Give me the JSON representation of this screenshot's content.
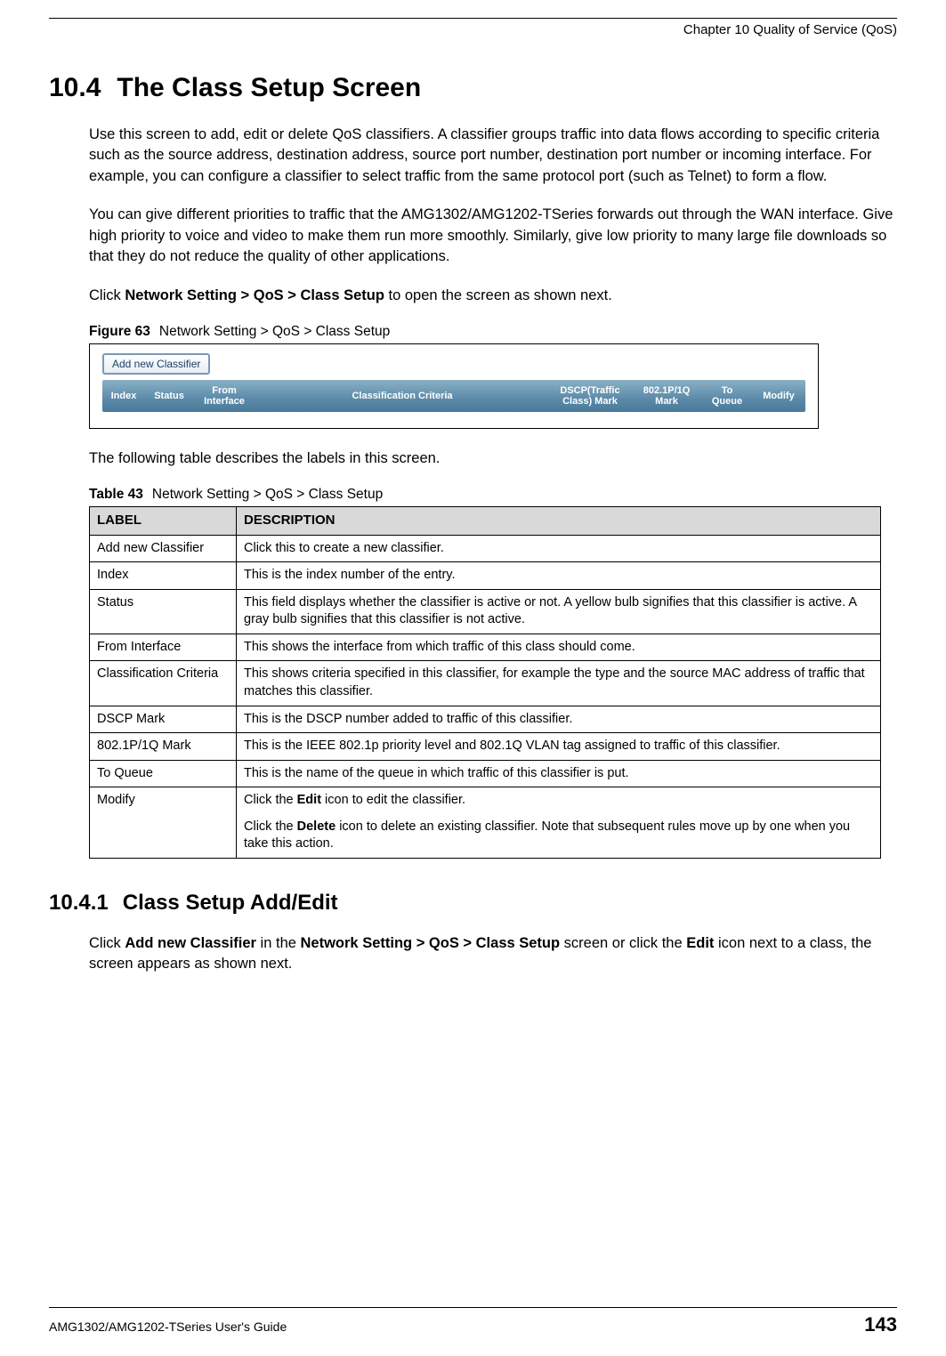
{
  "header": {
    "chapter": "Chapter 10 Quality of Service (QoS)"
  },
  "section": {
    "number": "10.4",
    "title": "The Class Setup Screen",
    "para1": "Use this screen to add, edit or delete QoS classifiers. A classifier groups traffic into data flows according to specific criteria such as the source address, destination address, source port number, destination port number or incoming interface. For example, you can configure a classifier to select traffic from the same protocol port (such as Telnet) to form a flow.",
    "para2": "You can give different priorities to traffic that the AMG1302/AMG1202-TSeries forwards out through the WAN interface. Give high priority to voice and video to make them run more smoothly. Similarly, give low priority to many large file downloads so that they do not reduce the quality of other applications.",
    "click_prefix": "Click ",
    "click_path": "Network Setting > QoS > Class Setup",
    "click_suffix": " to open the screen as shown next."
  },
  "figure": {
    "label": "Figure 63",
    "caption": "Network Setting > QoS > Class Setup",
    "add_button": "Add new Classifier",
    "columns": {
      "index": "Index",
      "status": "Status",
      "from": "From Interface",
      "criteria": "Classification Criteria",
      "dscp": "DSCP(Traffic Class) Mark",
      "p8021": "802.1P/1Q Mark",
      "toqueue": "To Queue",
      "modify": "Modify"
    }
  },
  "table_intro": "The following table describes the labels in this screen.",
  "table": {
    "label": "Table 43",
    "caption": "Network Setting > QoS > Class Setup",
    "header_label": "LABEL",
    "header_desc": "DESCRIPTION",
    "rows": [
      {
        "label": "Add new Classifier",
        "desc": "Click this to create a new classifier."
      },
      {
        "label": "Index",
        "desc": "This is the index number of the entry."
      },
      {
        "label": "Status",
        "desc": "This field displays whether the classifier is active or not. A yellow bulb signifies that this classifier is active. A gray bulb signifies that this classifier is not active."
      },
      {
        "label": "From Interface",
        "desc": "This shows the interface from which traffic of this class should come."
      },
      {
        "label": "Classification Criteria",
        "desc": "This shows criteria specified in this classifier, for example the type and the source MAC address of traffic that matches this classifier."
      },
      {
        "label": "DSCP Mark",
        "desc": "This is the DSCP number added to traffic of this classifier."
      },
      {
        "label": "802.1P/1Q Mark",
        "desc": "This is the IEEE 802.1p priority level and 802.1Q VLAN tag assigned to traffic of this classifier."
      },
      {
        "label": "To Queue",
        "desc": "This is the name of the queue in which traffic of this classifier is put."
      }
    ],
    "modify_label": "Modify",
    "modify_p1a": "Click the ",
    "modify_p1b": "Edit",
    "modify_p1c": " icon to edit the classifier.",
    "modify_p2a": "Click the ",
    "modify_p2b": "Delete",
    "modify_p2c": " icon to delete an existing classifier. Note that subsequent rules move up by one when you take this action."
  },
  "subsection": {
    "number": "10.4.1",
    "title": "Class Setup Add/Edit",
    "p_a": "Click ",
    "p_b": "Add new Classifier",
    "p_c": " in the ",
    "p_d": "Network Setting > QoS > Class Setup",
    "p_e": " screen or click the ",
    "p_f": "Edit",
    "p_g": " icon next to a class, the screen appears as shown next."
  },
  "footer": {
    "guide": "AMG1302/AMG1202-TSeries User's Guide",
    "page": "143"
  }
}
